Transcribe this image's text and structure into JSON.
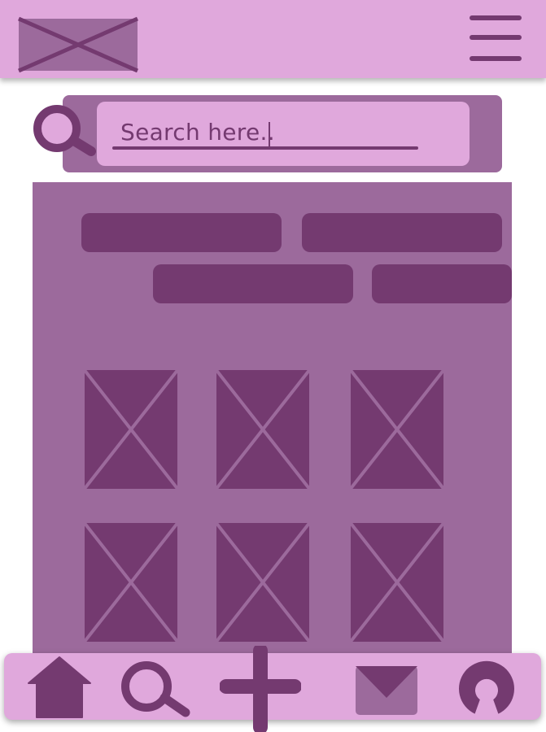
{
  "colors": {
    "header_bg": "#e0a8dc",
    "panel_bg": "#9c6a9c",
    "dark": "#743a70",
    "page_bg": "#ffffff"
  },
  "header": {
    "logo": "image-placeholder-icon",
    "menu": "hamburger-menu-icon"
  },
  "search": {
    "placeholder": "Search here..",
    "icon": "magnifier-icon"
  },
  "filters": {
    "chips": [
      "filter-chip",
      "filter-chip",
      "filter-chip",
      "filter-chip"
    ]
  },
  "gallery": {
    "items": [
      "image-placeholder",
      "image-placeholder",
      "image-placeholder",
      "image-placeholder",
      "image-placeholder",
      "image-placeholder"
    ]
  },
  "bottom_nav": {
    "items": [
      "home-icon",
      "search-icon",
      "add-icon",
      "dropdown-icon",
      "profile-icon"
    ]
  }
}
